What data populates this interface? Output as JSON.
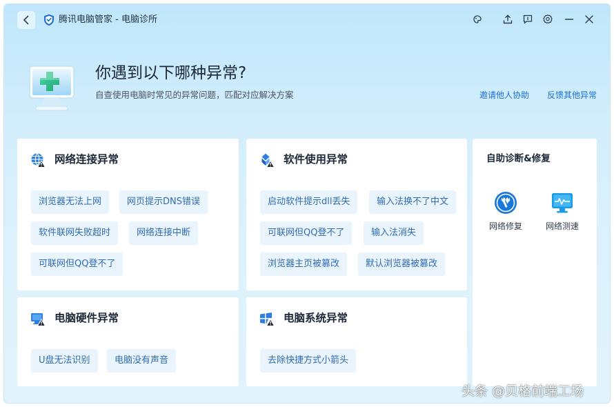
{
  "titlebar": {
    "app_name": "腾讯电脑管家 - 电脑诊所",
    "icons": [
      "back-icon",
      "shield-logo-icon",
      "skin-icon",
      "share-icon",
      "feedback-icon",
      "settings-icon",
      "minimize-icon",
      "close-icon"
    ]
  },
  "header": {
    "title": "你遇到以下哪种异常?",
    "subtitle": "自查使用电脑时常见的异常问题，匹配对应解决方案",
    "links": [
      "邀请他人协助",
      "反馈其他异常"
    ]
  },
  "cards": {
    "network": {
      "title": "网络连接异常",
      "chips": [
        "浏览器无法上网",
        "网页提示DNS错误",
        "软件联网失败超时",
        "网络连接中断",
        "可联网但QQ登不了"
      ]
    },
    "software": {
      "title": "软件使用异常",
      "chips": [
        "启动软件提示dll丢失",
        "输入法换不了中文",
        "可联网但QQ登不了",
        "输入法消失",
        "浏览器主页被篡改",
        "默认浏览器被篡改"
      ]
    },
    "hardware": {
      "title": "电脑硬件异常",
      "chips": [
        "U盘无法识别",
        "电脑没有声音"
      ]
    },
    "system": {
      "title": "电脑系统异常",
      "chips": [
        "去除快捷方式小箭头"
      ]
    }
  },
  "side_panel": {
    "title": "自助诊断&修复",
    "tools": [
      {
        "label": "网络修复",
        "icon": "network-repair-icon"
      },
      {
        "label": "网络测速",
        "icon": "network-speedtest-icon"
      }
    ]
  },
  "watermark": "头条 @贝格前端工场",
  "colors": {
    "accent": "#1d6fd8",
    "chip_bg": "#eaf4fd",
    "chip_text": "#2f6cb3",
    "bg_top": "#bfe6fb",
    "bg_bottom": "#e1f3fc"
  }
}
